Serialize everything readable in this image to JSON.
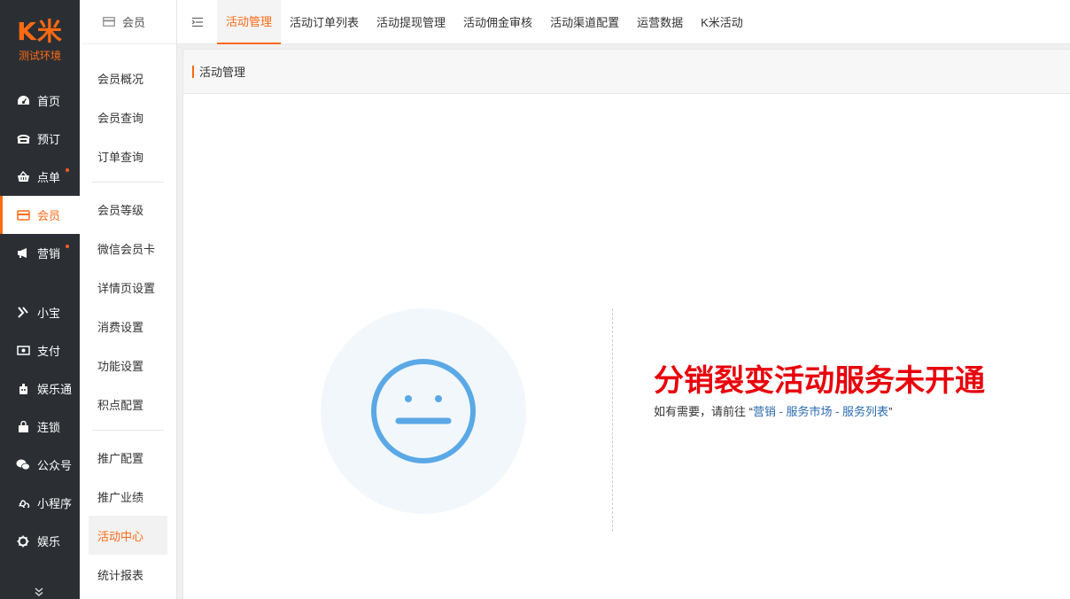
{
  "brand": {
    "logo": "K米",
    "env": "测试环境",
    "accent": "#ff6a13"
  },
  "sidebar": {
    "items": [
      {
        "label": "首页",
        "icon": "dashboard-icon"
      },
      {
        "label": "预订",
        "icon": "phone-icon"
      },
      {
        "label": "点单",
        "icon": "basket-icon",
        "dot": true
      },
      {
        "label": "会员",
        "icon": "card-icon",
        "active": true
      },
      {
        "label": "营销",
        "icon": "megaphone-icon",
        "dot": true
      },
      {
        "label": "小宝",
        "icon": "xiaobao-icon"
      },
      {
        "label": "支付",
        "icon": "money-icon"
      },
      {
        "label": "娱乐通",
        "icon": "robot-icon"
      },
      {
        "label": "连锁",
        "icon": "bag-icon"
      },
      {
        "label": "公众号",
        "icon": "wechat-icon"
      },
      {
        "label": "小程序",
        "icon": "miniprogram-icon"
      },
      {
        "label": "娱乐",
        "icon": "gear-icon"
      }
    ],
    "expand": "»"
  },
  "submenu": {
    "title": "会员",
    "group1": [
      "会员概况",
      "会员查询",
      "订单查询"
    ],
    "group2": [
      "会员等级",
      "微信会员卡",
      "详情页设置",
      "消费设置",
      "功能设置",
      "积点配置"
    ],
    "group3": [
      "推广配置",
      "推广业绩",
      "活动中心",
      "统计报表"
    ],
    "active": "活动中心"
  },
  "tabs": [
    "活动管理",
    "活动订单列表",
    "活动提现管理",
    "活动佣金审核",
    "活动渠道配置",
    "运营数据",
    "K米活动"
  ],
  "panel": {
    "title": "活动管理",
    "message": "分销裂变活动服务未开通",
    "hint_prefix": "如有需要，请前往 “",
    "hint_link": "营销 - 服务市场 - 服务列表",
    "hint_suffix": "”"
  }
}
